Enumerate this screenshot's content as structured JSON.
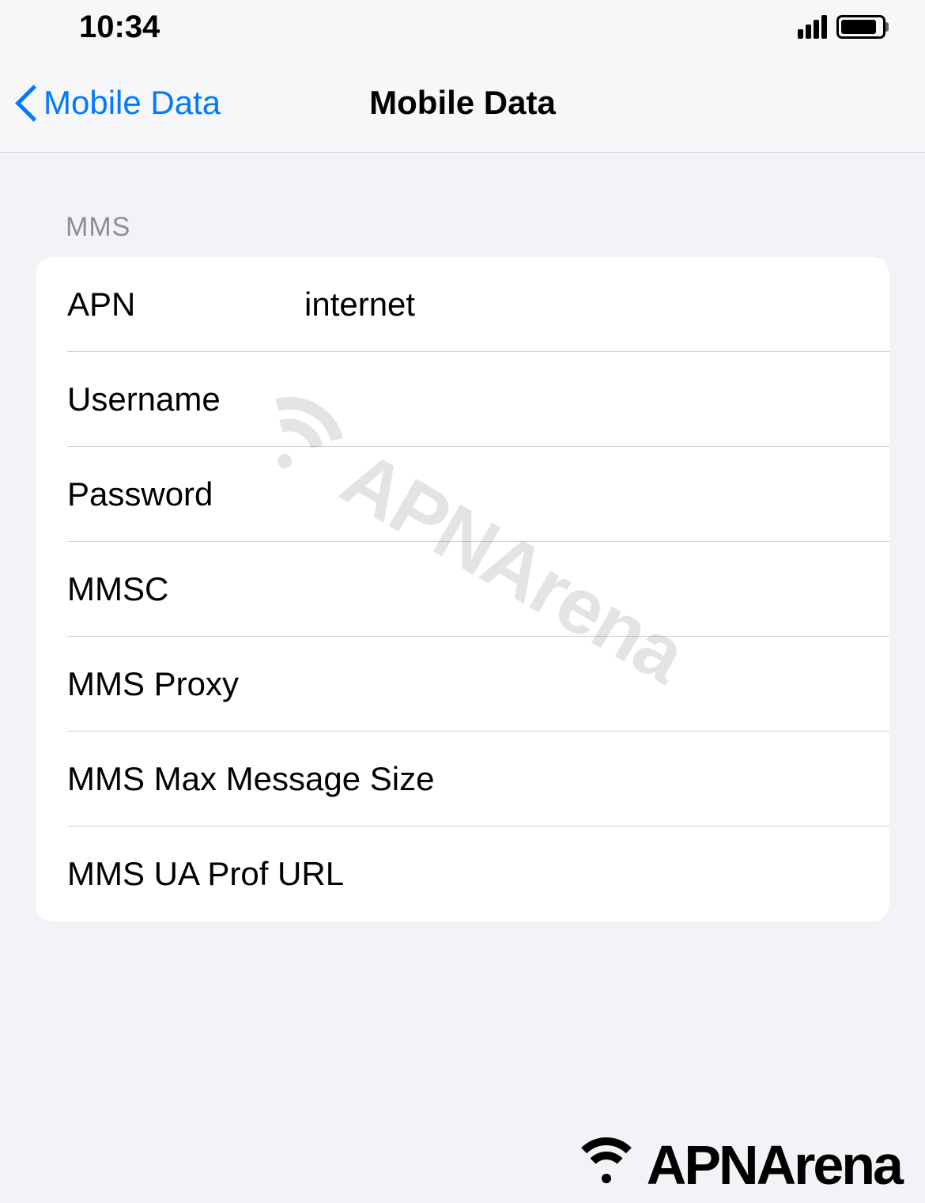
{
  "statusBar": {
    "time": "10:34"
  },
  "nav": {
    "backLabel": "Mobile Data",
    "title": "Mobile Data"
  },
  "section": {
    "header": "MMS",
    "rows": [
      {
        "label": "APN",
        "value": "internet"
      },
      {
        "label": "Username",
        "value": ""
      },
      {
        "label": "Password",
        "value": ""
      },
      {
        "label": "MMSC",
        "value": ""
      },
      {
        "label": "MMS Proxy",
        "value": ""
      },
      {
        "label": "MMS Max Message Size",
        "value": ""
      },
      {
        "label": "MMS UA Prof URL",
        "value": ""
      }
    ]
  },
  "branding": {
    "name": "APNArena"
  }
}
